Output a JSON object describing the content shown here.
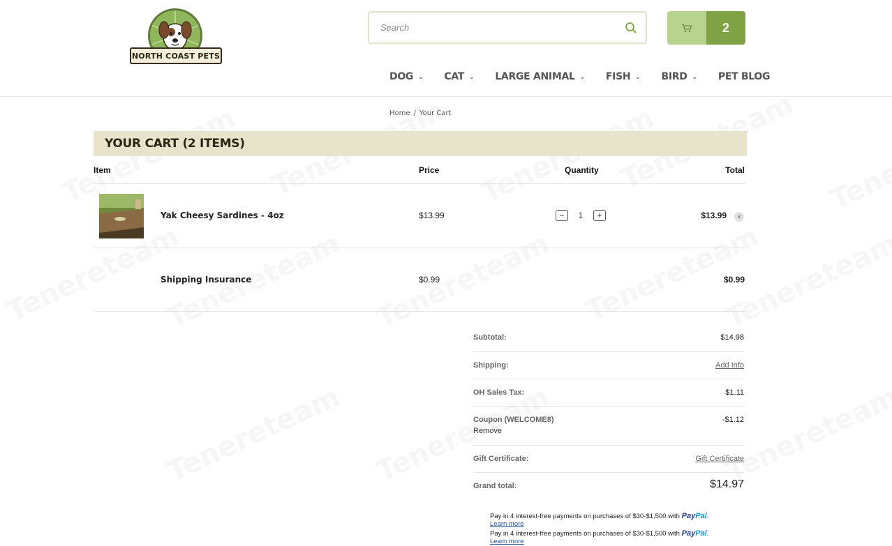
{
  "brand": {
    "name": "NORTH COAST PETS"
  },
  "search": {
    "placeholder": "Search"
  },
  "cart_button": {
    "count": "2"
  },
  "nav": [
    {
      "label": "DOG",
      "has_dropdown": true
    },
    {
      "label": "CAT",
      "has_dropdown": true
    },
    {
      "label": "LARGE ANIMAL",
      "has_dropdown": true
    },
    {
      "label": "FISH",
      "has_dropdown": true
    },
    {
      "label": "BIRD",
      "has_dropdown": true
    },
    {
      "label": "PET BLOG",
      "has_dropdown": false
    }
  ],
  "breadcrumb": {
    "home": "Home",
    "separator": "/",
    "current": "Your Cart"
  },
  "cart": {
    "title": "YOUR CART (2 ITEMS)",
    "columns": {
      "item": "Item",
      "price": "Price",
      "quantity": "Quantity",
      "total": "Total"
    },
    "items": [
      {
        "name": "Yak Cheesy Sardines - 4oz",
        "price": "$13.99",
        "quantity": "1",
        "total": "$13.99"
      },
      {
        "name": "Shipping Insurance",
        "price": "$0.99",
        "total": "$0.99"
      }
    ]
  },
  "totals": {
    "subtotal_label": "Subtotal:",
    "subtotal": "$14.98",
    "shipping_label": "Shipping:",
    "shipping_link": "Add Info",
    "tax_label": "OH Sales Tax:",
    "tax": "$1.11",
    "coupon_label": "Coupon (WELCOME8)",
    "coupon_remove": "Remove",
    "coupon": "-$1.12",
    "gift_label": "Gift Certificate:",
    "gift_link": "Gift Certificate",
    "grand_label": "Grand total:",
    "grand": "$14.97"
  },
  "paypal": {
    "message": "Pay in 4 interest-free payments on purchases of $30-$1,500 with",
    "brand_a": "Pay",
    "brand_b": "Pal",
    "period": ".",
    "learn_more": "Learn more"
  },
  "watermark": "Tenereteam",
  "colors": {
    "accent_green": "#7fa344",
    "light_green": "#b7d38e",
    "header_band": "#e8e4cc"
  }
}
